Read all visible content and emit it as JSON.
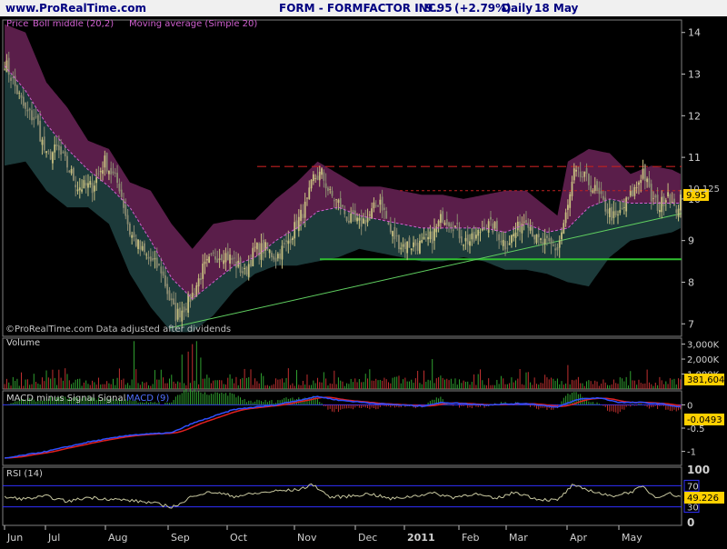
{
  "header": {
    "site": "www.ProRealTime.com",
    "title": "FORM - FORMFACTOR INC.",
    "last": "9.95",
    "change": "(+2.79%)",
    "period": "Daily",
    "date": "18 May"
  },
  "colors": {
    "background": "#000000",
    "header_bg": "#f0f0f0",
    "header_text": "#000080",
    "up_candle": "#c8c080",
    "bollinger_upper_fill": "#5a1e4a",
    "bollinger_lower_fill": "#1c3a3a",
    "sma_line": "#d060d0",
    "support_line": "#30c030",
    "trend_line": "#60d060",
    "resistance_dashed": "#c02020",
    "volume_bar": "#8a2a2a",
    "macd_line": "#3050ff",
    "signal_line": "#e02020",
    "macd_hist_pos": "#30a030",
    "macd_hist_neg": "#c03030",
    "rsi_line": "#c8c8a0",
    "rsi_band": "#3030ff",
    "last_price_box": "#ffd000",
    "grid": "#404040"
  },
  "chart_data": [
    {
      "type": "candlestick",
      "panel": "price",
      "labels": {
        "price": "Price",
        "bb": "Boll middle (20,2)",
        "ma": "Moving average (Simple 20)",
        "copyright": "©ProRealTime.com  Data adjusted after dividends",
        "last_value": "9.95",
        "level_value": "10.125"
      },
      "x_ticks": [
        "Jun",
        "Jul",
        "Aug",
        "Sep",
        "Oct",
        "Nov",
        "Dec",
        "2011",
        "Feb",
        "Mar",
        "Apr",
        "May"
      ],
      "y_ticks": [
        7,
        8,
        9,
        10,
        11,
        12,
        13,
        14
      ],
      "ylim": [
        6.7,
        14.3
      ],
      "close_anchors": [
        [
          0,
          13.3
        ],
        [
          5,
          12.7
        ],
        [
          10,
          12.1
        ],
        [
          15,
          11.9
        ],
        [
          20,
          11.0
        ],
        [
          25,
          11.2
        ],
        [
          30,
          10.8
        ],
        [
          35,
          10.3
        ],
        [
          42,
          10.3
        ],
        [
          48,
          10.9
        ],
        [
          55,
          10.3
        ],
        [
          60,
          9.2
        ],
        [
          65,
          8.8
        ],
        [
          70,
          8.5
        ],
        [
          75,
          8.3
        ],
        [
          79,
          7.6
        ],
        [
          82,
          7.2
        ],
        [
          86,
          7.4
        ],
        [
          90,
          7.7
        ],
        [
          95,
          8.3
        ],
        [
          100,
          8.6
        ],
        [
          105,
          8.7
        ],
        [
          110,
          8.5
        ],
        [
          115,
          8.2
        ],
        [
          120,
          8.8
        ],
        [
          125,
          8.8
        ],
        [
          130,
          8.6
        ],
        [
          135,
          8.9
        ],
        [
          140,
          9.4
        ],
        [
          145,
          9.9
        ],
        [
          148,
          10.5
        ],
        [
          152,
          10.6
        ],
        [
          156,
          10.1
        ],
        [
          160,
          9.9
        ],
        [
          165,
          9.5
        ],
        [
          170,
          9.4
        ],
        [
          175,
          9.6
        ],
        [
          180,
          10.0
        ],
        [
          185,
          9.2
        ],
        [
          190,
          8.9
        ],
        [
          195,
          8.9
        ],
        [
          200,
          8.9
        ],
        [
          205,
          9.1
        ],
        [
          210,
          9.6
        ],
        [
          215,
          9.4
        ],
        [
          220,
          9.0
        ],
        [
          225,
          9.0
        ],
        [
          230,
          9.4
        ],
        [
          235,
          9.3
        ],
        [
          240,
          8.9
        ],
        [
          245,
          9.2
        ],
        [
          250,
          9.6
        ],
        [
          255,
          9.0
        ],
        [
          260,
          8.9
        ],
        [
          265,
          8.8
        ],
        [
          270,
          9.8
        ],
        [
          273,
          10.6
        ],
        [
          278,
          10.5
        ],
        [
          283,
          10.2
        ],
        [
          288,
          9.8
        ],
        [
          293,
          9.5
        ],
        [
          298,
          9.9
        ],
        [
          303,
          10.3
        ],
        [
          306,
          10.7
        ],
        [
          310,
          10.0
        ],
        [
          314,
          9.8
        ],
        [
          318,
          10.2
        ],
        [
          321,
          9.7
        ],
        [
          324,
          9.95
        ]
      ],
      "bollinger_upper_anchors": [
        [
          0,
          14.2
        ],
        [
          10,
          14.0
        ],
        [
          20,
          12.8
        ],
        [
          30,
          12.2
        ],
        [
          40,
          11.4
        ],
        [
          50,
          11.2
        ],
        [
          60,
          10.4
        ],
        [
          70,
          10.2
        ],
        [
          80,
          9.4
        ],
        [
          90,
          8.8
        ],
        [
          100,
          9.4
        ],
        [
          110,
          9.5
        ],
        [
          120,
          9.5
        ],
        [
          130,
          10.0
        ],
        [
          140,
          10.4
        ],
        [
          150,
          10.9
        ],
        [
          160,
          10.6
        ],
        [
          170,
          10.3
        ],
        [
          180,
          10.3
        ],
        [
          190,
          10.2
        ],
        [
          200,
          10.1
        ],
        [
          210,
          10.1
        ],
        [
          220,
          10.0
        ],
        [
          230,
          10.1
        ],
        [
          240,
          10.2
        ],
        [
          250,
          10.2
        ],
        [
          260,
          9.8
        ],
        [
          265,
          9.6
        ],
        [
          270,
          10.9
        ],
        [
          280,
          11.2
        ],
        [
          290,
          11.1
        ],
        [
          300,
          10.6
        ],
        [
          310,
          10.8
        ],
        [
          320,
          10.7
        ],
        [
          324,
          10.6
        ]
      ],
      "bollinger_lower_anchors": [
        [
          0,
          10.8
        ],
        [
          10,
          10.9
        ],
        [
          20,
          10.2
        ],
        [
          30,
          9.8
        ],
        [
          40,
          9.8
        ],
        [
          50,
          9.4
        ],
        [
          60,
          8.2
        ],
        [
          70,
          7.4
        ],
        [
          80,
          6.8
        ],
        [
          90,
          6.8
        ],
        [
          100,
          7.2
        ],
        [
          110,
          7.8
        ],
        [
          120,
          8.2
        ],
        [
          130,
          8.4
        ],
        [
          140,
          8.4
        ],
        [
          150,
          8.5
        ],
        [
          160,
          8.6
        ],
        [
          170,
          8.8
        ],
        [
          180,
          8.7
        ],
        [
          190,
          8.6
        ],
        [
          200,
          8.5
        ],
        [
          210,
          8.5
        ],
        [
          220,
          8.6
        ],
        [
          230,
          8.5
        ],
        [
          240,
          8.3
        ],
        [
          250,
          8.3
        ],
        [
          260,
          8.2
        ],
        [
          270,
          8.0
        ],
        [
          280,
          7.9
        ],
        [
          290,
          8.6
        ],
        [
          300,
          9.0
        ],
        [
          310,
          9.1
        ],
        [
          320,
          9.2
        ],
        [
          324,
          9.3
        ]
      ],
      "sma_anchors": [
        [
          0,
          13.2
        ],
        [
          10,
          12.6
        ],
        [
          20,
          11.8
        ],
        [
          30,
          11.2
        ],
        [
          40,
          10.7
        ],
        [
          50,
          10.3
        ],
        [
          60,
          9.8
        ],
        [
          70,
          9.0
        ],
        [
          80,
          8.1
        ],
        [
          90,
          7.6
        ],
        [
          100,
          8.0
        ],
        [
          110,
          8.4
        ],
        [
          120,
          8.6
        ],
        [
          130,
          9.0
        ],
        [
          140,
          9.3
        ],
        [
          150,
          9.7
        ],
        [
          160,
          9.8
        ],
        [
          170,
          9.6
        ],
        [
          180,
          9.5
        ],
        [
          190,
          9.4
        ],
        [
          200,
          9.3
        ],
        [
          210,
          9.3
        ],
        [
          220,
          9.3
        ],
        [
          230,
          9.3
        ],
        [
          240,
          9.2
        ],
        [
          250,
          9.4
        ],
        [
          260,
          9.2
        ],
        [
          270,
          9.3
        ],
        [
          280,
          9.8
        ],
        [
          290,
          10.0
        ],
        [
          300,
          9.9
        ],
        [
          310,
          9.9
        ],
        [
          320,
          9.9
        ],
        [
          324,
          9.9
        ]
      ],
      "support_level": 8.55,
      "resistance_levels": [
        10.78,
        10.2
      ],
      "trend_line": [
        [
          79,
          6.9
        ],
        [
          340,
          9.65
        ]
      ]
    },
    {
      "type": "bar",
      "panel": "volume",
      "labels": {
        "name": "Volume",
        "last_value": "381,604"
      },
      "y_ticks": [
        "1,000K",
        "2,000K",
        "3,000K"
      ],
      "ylim": [
        0,
        3400
      ],
      "spike_days": {
        "62": 3200,
        "85": 2300,
        "88": 2500,
        "90": 3000,
        "92": 3200,
        "94": 2100,
        "205": 2000,
        "270": 1600,
        "300": 1200,
        "308": 1300
      }
    },
    {
      "type": "line",
      "panel": "macd",
      "labels": {
        "name": "MACD minus Signal Signal",
        "macd": "MACD (9)",
        "last_value": "-0.0493"
      },
      "y_ticks": [
        "-1",
        "-0.5",
        "0"
      ],
      "ylim": [
        -1.3,
        0.3
      ],
      "macd_anchors": [
        [
          0,
          -1.15
        ],
        [
          20,
          -1.0
        ],
        [
          40,
          -0.8
        ],
        [
          60,
          -0.65
        ],
        [
          80,
          -0.6
        ],
        [
          90,
          -0.4
        ],
        [
          110,
          -0.1
        ],
        [
          130,
          0.0
        ],
        [
          150,
          0.18
        ],
        [
          160,
          0.1
        ],
        [
          180,
          0.02
        ],
        [
          200,
          -0.03
        ],
        [
          210,
          0.05
        ],
        [
          230,
          0.0
        ],
        [
          250,
          0.03
        ],
        [
          265,
          -0.05
        ],
        [
          275,
          0.12
        ],
        [
          285,
          0.15
        ],
        [
          295,
          0.05
        ],
        [
          305,
          0.05
        ],
        [
          315,
          0.02
        ],
        [
          324,
          -0.05
        ]
      ]
    },
    {
      "type": "line",
      "panel": "rsi",
      "labels": {
        "name": "RSI (14)",
        "last_value": "49.226"
      },
      "y_ticks": [
        "0",
        "30",
        "70",
        "100"
      ],
      "ylim": [
        0,
        100
      ],
      "rsi_anchors": [
        [
          0,
          48
        ],
        [
          10,
          45
        ],
        [
          20,
          50
        ],
        [
          30,
          40
        ],
        [
          40,
          48
        ],
        [
          50,
          45
        ],
        [
          60,
          42
        ],
        [
          70,
          38
        ],
        [
          80,
          30
        ],
        [
          86,
          38
        ],
        [
          90,
          52
        ],
        [
          100,
          58
        ],
        [
          110,
          50
        ],
        [
          120,
          55
        ],
        [
          130,
          60
        ],
        [
          140,
          62
        ],
        [
          148,
          72
        ],
        [
          156,
          48
        ],
        [
          165,
          50
        ],
        [
          175,
          55
        ],
        [
          185,
          45
        ],
        [
          195,
          50
        ],
        [
          205,
          56
        ],
        [
          215,
          48
        ],
        [
          225,
          55
        ],
        [
          235,
          45
        ],
        [
          245,
          58
        ],
        [
          255,
          45
        ],
        [
          265,
          42
        ],
        [
          272,
          70
        ],
        [
          280,
          62
        ],
        [
          290,
          50
        ],
        [
          300,
          58
        ],
        [
          306,
          68
        ],
        [
          312,
          48
        ],
        [
          318,
          56
        ],
        [
          324,
          49
        ]
      ]
    }
  ]
}
